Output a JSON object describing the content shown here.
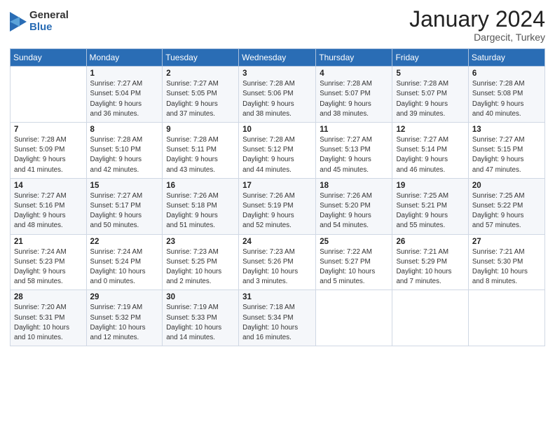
{
  "header": {
    "logo": {
      "general": "General",
      "blue": "Blue"
    },
    "title": "January 2024",
    "location": "Dargecit, Turkey"
  },
  "weekdays": [
    "Sunday",
    "Monday",
    "Tuesday",
    "Wednesday",
    "Thursday",
    "Friday",
    "Saturday"
  ],
  "weeks": [
    [
      {
        "day": "",
        "info": ""
      },
      {
        "day": "1",
        "info": "Sunrise: 7:27 AM\nSunset: 5:04 PM\nDaylight: 9 hours\nand 36 minutes."
      },
      {
        "day": "2",
        "info": "Sunrise: 7:27 AM\nSunset: 5:05 PM\nDaylight: 9 hours\nand 37 minutes."
      },
      {
        "day": "3",
        "info": "Sunrise: 7:28 AM\nSunset: 5:06 PM\nDaylight: 9 hours\nand 38 minutes."
      },
      {
        "day": "4",
        "info": "Sunrise: 7:28 AM\nSunset: 5:07 PM\nDaylight: 9 hours\nand 38 minutes."
      },
      {
        "day": "5",
        "info": "Sunrise: 7:28 AM\nSunset: 5:07 PM\nDaylight: 9 hours\nand 39 minutes."
      },
      {
        "day": "6",
        "info": "Sunrise: 7:28 AM\nSunset: 5:08 PM\nDaylight: 9 hours\nand 40 minutes."
      }
    ],
    [
      {
        "day": "7",
        "info": "Sunrise: 7:28 AM\nSunset: 5:09 PM\nDaylight: 9 hours\nand 41 minutes."
      },
      {
        "day": "8",
        "info": "Sunrise: 7:28 AM\nSunset: 5:10 PM\nDaylight: 9 hours\nand 42 minutes."
      },
      {
        "day": "9",
        "info": "Sunrise: 7:28 AM\nSunset: 5:11 PM\nDaylight: 9 hours\nand 43 minutes."
      },
      {
        "day": "10",
        "info": "Sunrise: 7:28 AM\nSunset: 5:12 PM\nDaylight: 9 hours\nand 44 minutes."
      },
      {
        "day": "11",
        "info": "Sunrise: 7:27 AM\nSunset: 5:13 PM\nDaylight: 9 hours\nand 45 minutes."
      },
      {
        "day": "12",
        "info": "Sunrise: 7:27 AM\nSunset: 5:14 PM\nDaylight: 9 hours\nand 46 minutes."
      },
      {
        "day": "13",
        "info": "Sunrise: 7:27 AM\nSunset: 5:15 PM\nDaylight: 9 hours\nand 47 minutes."
      }
    ],
    [
      {
        "day": "14",
        "info": "Sunrise: 7:27 AM\nSunset: 5:16 PM\nDaylight: 9 hours\nand 48 minutes."
      },
      {
        "day": "15",
        "info": "Sunrise: 7:27 AM\nSunset: 5:17 PM\nDaylight: 9 hours\nand 50 minutes."
      },
      {
        "day": "16",
        "info": "Sunrise: 7:26 AM\nSunset: 5:18 PM\nDaylight: 9 hours\nand 51 minutes."
      },
      {
        "day": "17",
        "info": "Sunrise: 7:26 AM\nSunset: 5:19 PM\nDaylight: 9 hours\nand 52 minutes."
      },
      {
        "day": "18",
        "info": "Sunrise: 7:26 AM\nSunset: 5:20 PM\nDaylight: 9 hours\nand 54 minutes."
      },
      {
        "day": "19",
        "info": "Sunrise: 7:25 AM\nSunset: 5:21 PM\nDaylight: 9 hours\nand 55 minutes."
      },
      {
        "day": "20",
        "info": "Sunrise: 7:25 AM\nSunset: 5:22 PM\nDaylight: 9 hours\nand 57 minutes."
      }
    ],
    [
      {
        "day": "21",
        "info": "Sunrise: 7:24 AM\nSunset: 5:23 PM\nDaylight: 9 hours\nand 58 minutes."
      },
      {
        "day": "22",
        "info": "Sunrise: 7:24 AM\nSunset: 5:24 PM\nDaylight: 10 hours\nand 0 minutes."
      },
      {
        "day": "23",
        "info": "Sunrise: 7:23 AM\nSunset: 5:25 PM\nDaylight: 10 hours\nand 2 minutes."
      },
      {
        "day": "24",
        "info": "Sunrise: 7:23 AM\nSunset: 5:26 PM\nDaylight: 10 hours\nand 3 minutes."
      },
      {
        "day": "25",
        "info": "Sunrise: 7:22 AM\nSunset: 5:27 PM\nDaylight: 10 hours\nand 5 minutes."
      },
      {
        "day": "26",
        "info": "Sunrise: 7:21 AM\nSunset: 5:29 PM\nDaylight: 10 hours\nand 7 minutes."
      },
      {
        "day": "27",
        "info": "Sunrise: 7:21 AM\nSunset: 5:30 PM\nDaylight: 10 hours\nand 8 minutes."
      }
    ],
    [
      {
        "day": "28",
        "info": "Sunrise: 7:20 AM\nSunset: 5:31 PM\nDaylight: 10 hours\nand 10 minutes."
      },
      {
        "day": "29",
        "info": "Sunrise: 7:19 AM\nSunset: 5:32 PM\nDaylight: 10 hours\nand 12 minutes."
      },
      {
        "day": "30",
        "info": "Sunrise: 7:19 AM\nSunset: 5:33 PM\nDaylight: 10 hours\nand 14 minutes."
      },
      {
        "day": "31",
        "info": "Sunrise: 7:18 AM\nSunset: 5:34 PM\nDaylight: 10 hours\nand 16 minutes."
      },
      {
        "day": "",
        "info": ""
      },
      {
        "day": "",
        "info": ""
      },
      {
        "day": "",
        "info": ""
      }
    ]
  ]
}
